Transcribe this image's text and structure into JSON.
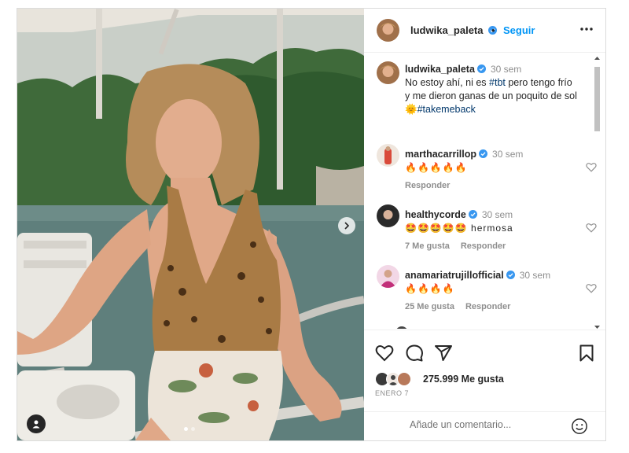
{
  "post": {
    "author": {
      "username": "ludwika_paleta",
      "verified": true,
      "follow_label": "Seguir",
      "separator": "•"
    },
    "caption": {
      "username": "ludwika_paleta",
      "time": "30 sem",
      "text_before": "No estoy ahí, ni es ",
      "hashtag1": "#tbt",
      "text_middle": " pero tengo frío y me dieron ganas de un poquito de sol ",
      "sun_emoji": "🌞",
      "hashtag2": "#takemeback"
    },
    "comments": [
      {
        "username": "marthacarrillop",
        "time": "30 sem",
        "text": "🔥🔥🔥🔥🔥",
        "likes": "",
        "reply_label": "Responder",
        "avatar_color": "#d94a3a"
      },
      {
        "username": "healthycorde",
        "time": "30 sem",
        "text": "🤩🤩🤩🤩🤩 hermosa",
        "likes": "7 Me gusta",
        "reply_label": "Responder",
        "avatar_color": "#2a2a2a"
      },
      {
        "username": "anamariatrujillofficial",
        "time": "30 sem",
        "text": "🔥🔥🔥🔥",
        "likes": "25 Me gusta",
        "reply_label": "Responder",
        "avatar_color": "#c2307a"
      }
    ],
    "likes_label": "275.999 Me gusta",
    "date": "ENERO 7",
    "comment_placeholder": "Añade un comentario...",
    "carousel": {
      "count": 2,
      "active": 0
    }
  },
  "colors": {
    "accent": "#0095f6",
    "verified": "#3897f0",
    "hashtag": "#00376b",
    "muted": "#8e8e8e"
  },
  "icons": {
    "more": "more-horizontal-icon",
    "like": "heart-icon",
    "comment": "comment-icon",
    "share": "send-icon",
    "save": "bookmark-icon",
    "emoji": "emoji-icon",
    "next": "chevron-right-icon",
    "tag": "user-tag-icon"
  }
}
